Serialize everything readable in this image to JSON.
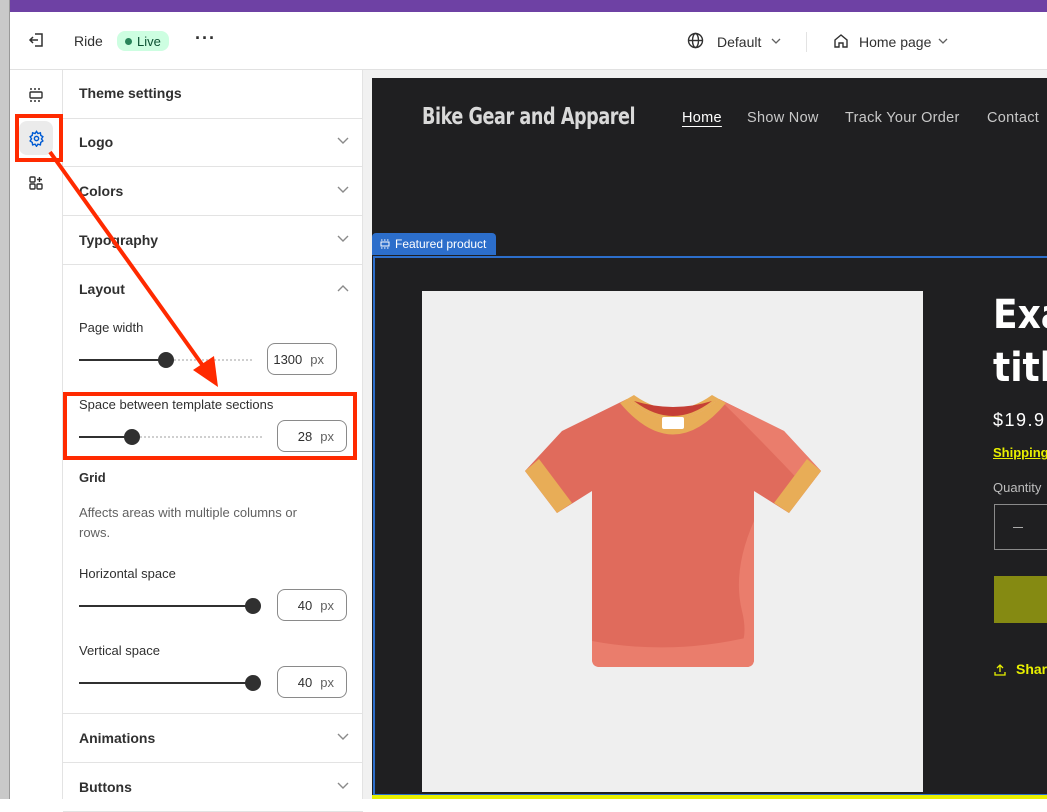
{
  "header": {
    "store_name": "Ride",
    "status_badge": "Live",
    "theme_selector": "Default",
    "page_selector": "Home page"
  },
  "panel": {
    "title": "Theme settings",
    "sections": [
      {
        "label": "Logo"
      },
      {
        "label": "Colors"
      },
      {
        "label": "Typography"
      },
      {
        "label": "Layout"
      },
      {
        "label": "Animations"
      },
      {
        "label": "Buttons"
      }
    ],
    "layout": {
      "page_width": {
        "label": "Page width",
        "value": "1300",
        "unit": "px",
        "fill": 0.5
      },
      "section_space": {
        "label": "Space between template sections",
        "value": "28",
        "unit": "px",
        "fill": 0.29
      },
      "grid": {
        "label": "Grid",
        "help": "Affects areas with multiple columns or rows."
      },
      "horizontal_space": {
        "label": "Horizontal space",
        "value": "40",
        "unit": "px",
        "fill": 1.0
      },
      "vertical_space": {
        "label": "Vertical space",
        "value": "40",
        "unit": "px",
        "fill": 1.0
      }
    }
  },
  "store": {
    "logo": "Bike Gear and Apparel",
    "nav": [
      "Home",
      "Show Now",
      "Track Your Order",
      "Contact"
    ],
    "section_tag": "Featured product",
    "title_line1": "Exa",
    "title_line2": "titl",
    "price": "$19.9",
    "shipping": "Shipping",
    "quantity_label": "Quantity",
    "share": "Shar"
  },
  "colors": {
    "accent": "#2c6ecb",
    "annotation": "#ff2a00",
    "purple": "#6e41a4",
    "add_button": "#858a12",
    "link": "#e8f000"
  }
}
